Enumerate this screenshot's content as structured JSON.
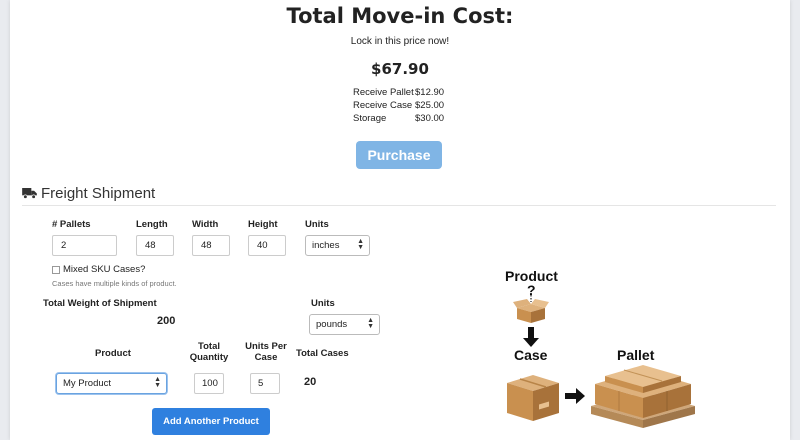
{
  "summary": {
    "title": "Total Move-in Cost:",
    "subtitle": "Lock in this price now!",
    "total": "$67.90",
    "items": [
      {
        "label": "Receive Pallet",
        "value": "$12.90"
      },
      {
        "label": "Receive Case",
        "value": "$25.00"
      },
      {
        "label": "Storage",
        "value": "$30.00"
      }
    ],
    "purchase_label": "Purchase"
  },
  "freight": {
    "heading": "Freight Shipment",
    "icon": "truck-icon",
    "fields": {
      "pallets_label": "# Pallets",
      "pallets_value": "2",
      "length_label": "Length",
      "length_value": "48",
      "width_label": "Width",
      "width_value": "48",
      "height_label": "Height",
      "height_value": "40",
      "units_label": "Units",
      "units_value": "inches"
    },
    "mixed_sku_label": "Mixed SKU Cases?",
    "mixed_sku_help": "Cases have multiple kinds of product.",
    "mixed_sku_checked": false,
    "weight_label": "Total Weight of Shipment",
    "weight_value": "200",
    "weight_units_label": "Units",
    "weight_units_value": "pounds",
    "table_headers": {
      "product": "Product",
      "total_qty_line1": "Total",
      "total_qty_line2": "Quantity",
      "units_per_case_line1": "Units Per",
      "units_per_case_line2": "Case",
      "total_cases": "Total Cases"
    },
    "product_row": {
      "product": "My Product",
      "quantity": "100",
      "units_per_case": "5",
      "total_cases": "20"
    },
    "add_product_label": "Add Another Product"
  },
  "diagram": {
    "product_label": "Product",
    "question": "?",
    "case_label": "Case",
    "pallet_label": "Pallet",
    "box_color": "#c9904f",
    "box_light": "#deb17c",
    "box_dark": "#a8723a",
    "pallet_wood": "#cfa77a"
  },
  "colors": {
    "purchase_button": "#80b5e5",
    "add_button": "#2f80df"
  }
}
